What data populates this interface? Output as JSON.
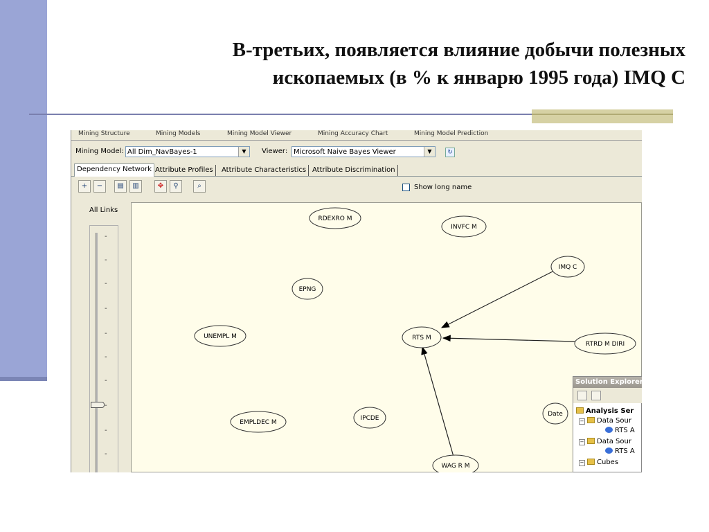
{
  "slide": {
    "title_line1": "В-третьих, появляется влияние добычи полезных",
    "title_line2": "ископаемых (в % к январю 1995 года) IMQ C"
  },
  "app": {
    "top_tabs": [
      "Mining Structure",
      "Mining Models",
      "Mining Model Viewer",
      "Mining Accuracy Chart",
      "Mining Model Prediction"
    ],
    "mining_model_label": "Mining Model:",
    "mining_model_value": "All Dim_NavBayes-1",
    "viewer_label": "Viewer:",
    "viewer_value": "Microsoft Naive Bayes Viewer",
    "tabs": [
      "Dependency Network",
      "Attribute Profiles",
      "Attribute Characteristics",
      "Attribute Discrimination"
    ],
    "show_long_name": "Show long name",
    "all_links": "All Links",
    "slider_level": 0.7
  },
  "network": {
    "nodes": [
      "RDEXRO M",
      "INVFC M",
      "IMQ C",
      "EPNG",
      "UNEMPL M",
      "RTS M",
      "RTRD M DIRI",
      "EMPLDEC M",
      "IPCDE",
      "Date",
      "WAG R M"
    ]
  },
  "solution_explorer": {
    "title": "Solution Explorer",
    "items": [
      "Analysis Ser",
      "Data Sour",
      "RTS A",
      "Data Sour",
      "RTS A",
      "Cubes"
    ]
  }
}
